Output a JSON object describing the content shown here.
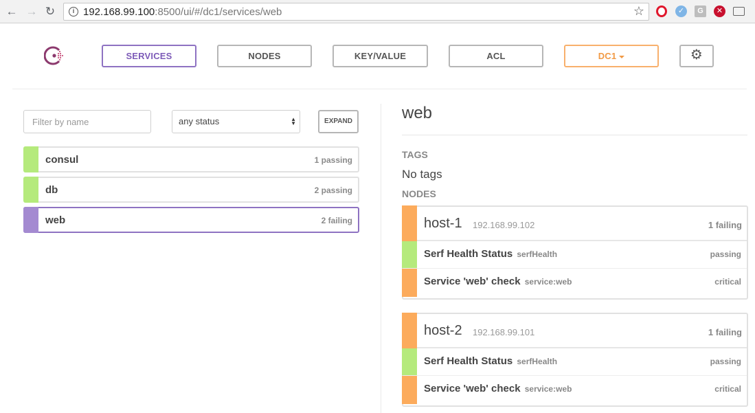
{
  "browser": {
    "url_host": "192.168.99.100",
    "url_rest": ":8500/ui/#/dc1/services/web",
    "extensions": [
      "opera-icon",
      "vpn-icon",
      "g-icon",
      "block-icon",
      "cast-icon"
    ]
  },
  "nav": {
    "services": "SERVICES",
    "nodes": "NODES",
    "keyvalue": "KEY/VALUE",
    "acl": "ACL",
    "datacenter": "DC1",
    "settings_icon": "gear-icon"
  },
  "filters": {
    "name_placeholder": "Filter by name",
    "status_selected": "any status",
    "expand_label": "EXPAND"
  },
  "services": [
    {
      "name": "consul",
      "status": "1 passing",
      "color": "#b5ea7c",
      "active": false
    },
    {
      "name": "db",
      "status": "2 passing",
      "color": "#b5ea7c",
      "active": false
    },
    {
      "name": "web",
      "status": "2 failing",
      "color": "#a48ad1",
      "active": true
    }
  ],
  "detail": {
    "title": "web",
    "tags_label": "TAGS",
    "tags_value": "No tags",
    "nodes_label": "NODES",
    "nodes": [
      {
        "name": "host-1",
        "ip": "192.168.99.102",
        "status": "1 failing",
        "checks": [
          {
            "name": "Serf Health Status",
            "id": "serfHealth",
            "status": "passing",
            "color": "#b5ea7c"
          },
          {
            "name": "Service 'web' check",
            "id": "service:web",
            "status": "critical",
            "color": "#fcab5c"
          }
        ]
      },
      {
        "name": "host-2",
        "ip": "192.168.99.101",
        "status": "1 failing",
        "checks": [
          {
            "name": "Serf Health Status",
            "id": "serfHealth",
            "status": "passing",
            "color": "#b5ea7c"
          },
          {
            "name": "Service 'web' check",
            "id": "service:web",
            "status": "critical",
            "color": "#fcab5c"
          }
        ]
      }
    ]
  },
  "colors": {
    "accent_purple": "#8e72c2",
    "dc_orange": "#f19a45",
    "passing": "#b5ea7c",
    "warning": "#fcab5c"
  }
}
